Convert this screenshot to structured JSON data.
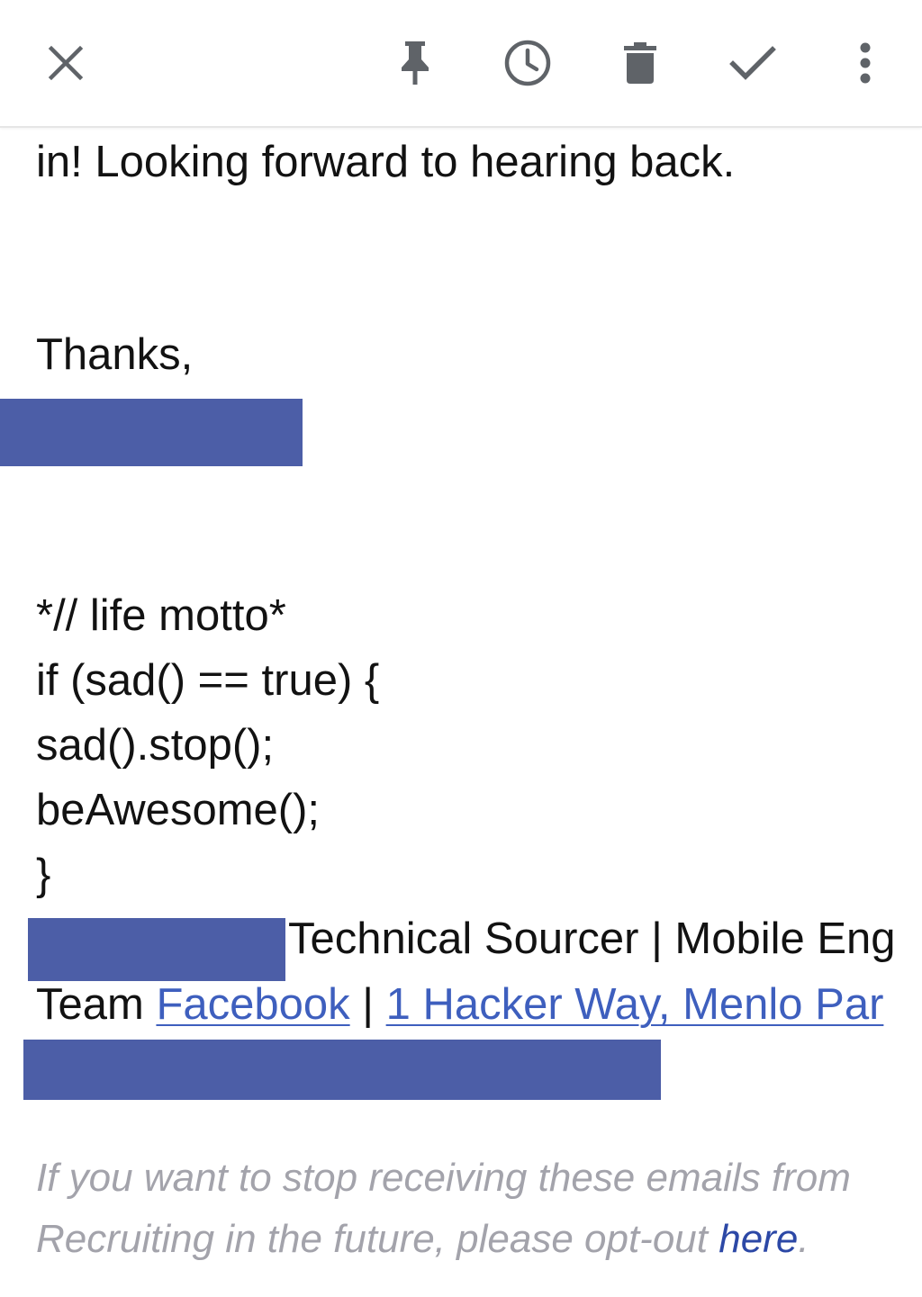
{
  "toolbar": {
    "icons": [
      "close-icon",
      "pin-icon",
      "snooze-clock-icon",
      "trash-icon",
      "checkmark-icon",
      "more-vert-icon"
    ]
  },
  "email": {
    "closing_line": "in! Looking forward to hearing back.",
    "signoff": "Thanks,",
    "motto_comment": "*// life motto*",
    "code_lines": [
      "if (sad() == true) {",
      "sad().stop();",
      "beAwesome();",
      "}"
    ],
    "signature": {
      "role": "Technical Sourcer | Mobile Eng",
      "team_prefix": "Team ",
      "company_link": "Facebook",
      "separator": " | ",
      "address_link": "1 Hacker Way, Menlo Par"
    },
    "footer": {
      "line1": "If you want to stop receiving these emails from",
      "line2_prefix": "Recruiting in the future, please opt-out ",
      "optout_link": "here",
      "line2_suffix": "."
    }
  },
  "colors": {
    "redaction": "#4c5ea7",
    "link": "#3e5fbe",
    "footer_text": "#a3a3ab",
    "footer_link": "#2c48a6"
  }
}
